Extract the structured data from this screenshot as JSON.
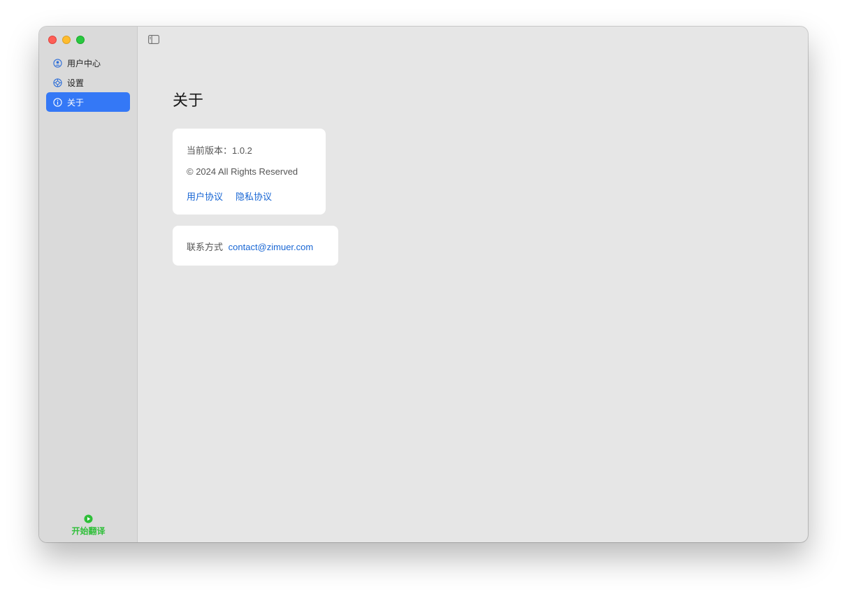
{
  "window": {
    "traffic_lights": [
      "close",
      "minimize",
      "zoom"
    ]
  },
  "sidebar": {
    "items": [
      {
        "label": "用户中心",
        "icon": "user-circle-icon",
        "active": false
      },
      {
        "label": "设置",
        "icon": "settings-gear-icon",
        "active": false
      },
      {
        "label": "关于",
        "icon": "info-circle-icon",
        "active": true
      }
    ],
    "start_button": {
      "label": "开始翻译",
      "icon": "play-circle-icon",
      "color": "#2fbf39"
    }
  },
  "toolbar": {
    "toggle_sidebar_icon": "sidebar-toggle-icon"
  },
  "main": {
    "title": "关于",
    "version_text": "当前版本：1.0.2",
    "copyright_text": "© 2024 All Rights Reserved",
    "links": {
      "user_agreement": "用户协议",
      "privacy_policy": "隐私协议"
    },
    "contact": {
      "label": "联系方式",
      "email": "contact@zimuer.com"
    }
  },
  "colors": {
    "accent": "#3478f6",
    "link": "#1866d4",
    "start": "#2fbf39"
  }
}
